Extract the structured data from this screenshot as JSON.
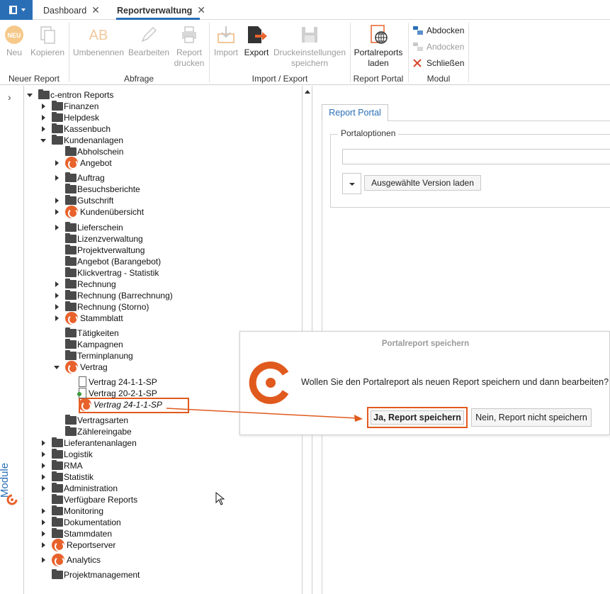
{
  "tabs": {
    "dashboard": "Dashboard",
    "reportverwaltung": "Reportverwaltung",
    "close_glyph": "✕"
  },
  "ribbon": {
    "neu_badge": "NEU",
    "neu": "Neu",
    "kopieren": "Kopieren",
    "umbenennen": "Umbenennen",
    "bearbeiten": "Bearbeiten",
    "report_drucken_1": "Report",
    "report_drucken_2": "drucken",
    "import": "Import",
    "export": "Export",
    "druckeinstellungen_1": "Druckeinstellungen",
    "druckeinstellungen_2": "speichern",
    "portalreports_1": "Portalreports",
    "portalreports_2": "laden",
    "abdocken": "Abdocken",
    "andocken": "Andocken",
    "schliessen": "Schließen",
    "groups": {
      "neuer_report": "Neuer Report",
      "abfrage": "Abfrage",
      "import_export": "Import / Export",
      "report_portal": "Report Portal",
      "modul": "Modul"
    }
  },
  "sidebar": {
    "module_label": "Module",
    "expand_glyph": "›"
  },
  "tree": {
    "rows": [
      {
        "label": "c-entron Reports",
        "icon": "folder",
        "expander": "open"
      },
      {
        "label": "Finanzen",
        "icon": "folder",
        "expander": "closed"
      },
      {
        "label": "Helpdesk",
        "icon": "folder",
        "expander": "closed"
      },
      {
        "label": "Kassenbuch",
        "icon": "folder",
        "expander": "closed"
      },
      {
        "label": "Kundenanlagen",
        "icon": "folder",
        "expander": "open"
      },
      {
        "label": "Abholschein",
        "icon": "folder",
        "expander": "none"
      },
      {
        "label": "Angebot",
        "icon": "report",
        "expander": "closed"
      },
      {
        "label": "Auftrag",
        "icon": "folder",
        "expander": "closed"
      },
      {
        "label": "Besuchsberichte",
        "icon": "folder",
        "expander": "none"
      },
      {
        "label": "Gutschrift",
        "icon": "folder",
        "expander": "closed"
      },
      {
        "label": "Kundenübersicht",
        "icon": "report",
        "expander": "closed"
      },
      {
        "label": "Lieferschein",
        "icon": "folder",
        "expander": "closed"
      },
      {
        "label": "Lizenzverwaltung",
        "icon": "folder",
        "expander": "none"
      },
      {
        "label": "Projektverwaltung",
        "icon": "folder",
        "expander": "none"
      },
      {
        "label": "Angebot (Barangebot)",
        "icon": "folder",
        "expander": "none"
      },
      {
        "label": "Klickvertrag - Statistik",
        "icon": "folder",
        "expander": "none"
      },
      {
        "label": "Rechnung",
        "icon": "folder",
        "expander": "closed"
      },
      {
        "label": "Rechnung (Barrechnung)",
        "icon": "folder",
        "expander": "closed"
      },
      {
        "label": "Rechnung (Storno)",
        "icon": "folder",
        "expander": "closed"
      },
      {
        "label": "Stammblatt",
        "icon": "report",
        "expander": "closed"
      },
      {
        "label": "Tätigkeiten",
        "icon": "folder",
        "expander": "none"
      },
      {
        "label": "Kampagnen",
        "icon": "folder",
        "expander": "none"
      },
      {
        "label": "Terminplanung",
        "icon": "folder",
        "expander": "none"
      },
      {
        "label": "Vertrag",
        "icon": "report",
        "expander": "open"
      },
      {
        "label": "Vertrag 24-1-1-SP",
        "icon": "doc",
        "expander": "none"
      },
      {
        "label": "Vertrag 20-2-1-SP",
        "icon": "doc-green",
        "expander": "none"
      },
      {
        "label": "Vertrag 24-1-1-SP",
        "icon": "report",
        "expander": "none",
        "selected": true
      },
      {
        "label": "Vertragsarten",
        "icon": "folder",
        "expander": "none"
      },
      {
        "label": "Zählereingabe",
        "icon": "folder",
        "expander": "none"
      },
      {
        "label": "Lieferantenanlagen",
        "icon": "folder",
        "expander": "closed"
      },
      {
        "label": "Logistik",
        "icon": "folder",
        "expander": "closed"
      },
      {
        "label": "RMA",
        "icon": "folder",
        "expander": "closed"
      },
      {
        "label": "Statistik",
        "icon": "folder",
        "expander": "closed"
      },
      {
        "label": "Administration",
        "icon": "folder",
        "expander": "closed"
      },
      {
        "label": "Verfügbare Reports",
        "icon": "folder",
        "expander": "none"
      },
      {
        "label": "Monitoring",
        "icon": "folder",
        "expander": "closed"
      },
      {
        "label": "Dokumentation",
        "icon": "folder",
        "expander": "closed"
      },
      {
        "label": "Stammdaten",
        "icon": "folder",
        "expander": "closed"
      },
      {
        "label": "Reportserver",
        "icon": "report",
        "expander": "closed"
      },
      {
        "label": "Analytics",
        "icon": "report",
        "expander": "closed"
      },
      {
        "label": "Projektmanagement",
        "icon": "folder",
        "expander": "none"
      }
    ]
  },
  "portal": {
    "tab_label": "Report Portal",
    "group_title": "Portaloptionen",
    "input_value": "",
    "load_version_button": "Ausgewählte Version laden"
  },
  "dialog": {
    "title": "Portalreport speichern",
    "message": "Wollen Sie den Portalreport als neuen Report speichern und dann bearbeiten?",
    "yes_button": "Ja, Report speichern",
    "no_button": "Nein, Report nicht speichern"
  },
  "colors": {
    "accent_blue": "#2a6fb6",
    "brand_orange": "#e05a1e"
  }
}
